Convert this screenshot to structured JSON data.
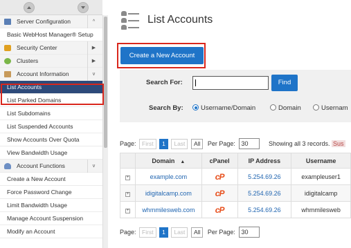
{
  "sidebar": {
    "items": [
      {
        "label": "Server Configuration",
        "type": "category",
        "icon": "server-icon"
      },
      {
        "label": "Basic WebHost Manager® Setup",
        "type": "link"
      },
      {
        "label": "Security Center",
        "type": "category",
        "icon": "lock-icon"
      },
      {
        "label": "Clusters",
        "type": "category",
        "icon": "cluster-icon"
      },
      {
        "label": "Account Information",
        "type": "category",
        "icon": "account-info-icon"
      },
      {
        "label": "List Accounts",
        "type": "link",
        "active": true
      },
      {
        "label": "List Parked Domains",
        "type": "link"
      },
      {
        "label": "List Subdomains",
        "type": "link"
      },
      {
        "label": "List Suspended Accounts",
        "type": "link"
      },
      {
        "label": "Show Accounts Over Quota",
        "type": "link"
      },
      {
        "label": "View Bandwidth Usage",
        "type": "link"
      },
      {
        "label": "Account Functions",
        "type": "category",
        "icon": "user-icon"
      },
      {
        "label": "Create a New Account",
        "type": "link"
      },
      {
        "label": "Force Password Change",
        "type": "link"
      },
      {
        "label": "Limit Bandwidth Usage",
        "type": "link"
      },
      {
        "label": "Manage Account Suspension",
        "type": "link"
      },
      {
        "label": "Modify an Account",
        "type": "link"
      }
    ]
  },
  "main": {
    "title": "List Accounts",
    "create_button": "Create a New Account",
    "search": {
      "for_label": "Search For:",
      "value": "",
      "find_button": "Find",
      "by_label": "Search By:",
      "options": [
        "Username/Domain",
        "Domain",
        "Usernam"
      ],
      "selected": "Username/Domain"
    },
    "pager": {
      "page_label": "Page:",
      "first": "First",
      "current": "1",
      "last": "Last",
      "all": "All",
      "per_page_label": "Per Page:",
      "per_page_value": "30",
      "showing": "Showing all 3 records.",
      "suspended_fragment": "Sus"
    },
    "table": {
      "columns": [
        "Domain",
        "cPanel",
        "IP Address",
        "Username"
      ],
      "sort_indicator": "▲",
      "rows": [
        {
          "expand": "+",
          "domain": "example.com",
          "cpanel": "cP",
          "ip": "5.254.69.26",
          "username": "exampleuser1"
        },
        {
          "expand": "+",
          "domain": "idigitalcamp.com",
          "cpanel": "cP",
          "ip": "5.254.69.26",
          "username": "idigitalcamp"
        },
        {
          "expand": "+",
          "domain": "whmmilesweb.com",
          "cpanel": "cP",
          "ip": "5.254.69.26",
          "username": "whmmilesweb"
        }
      ]
    }
  },
  "colors": {
    "accent": "#1f74c8",
    "active_nav": "#2d4a7a",
    "highlight_box": "#d9261c",
    "cpanel_logo": "#e8501d"
  }
}
